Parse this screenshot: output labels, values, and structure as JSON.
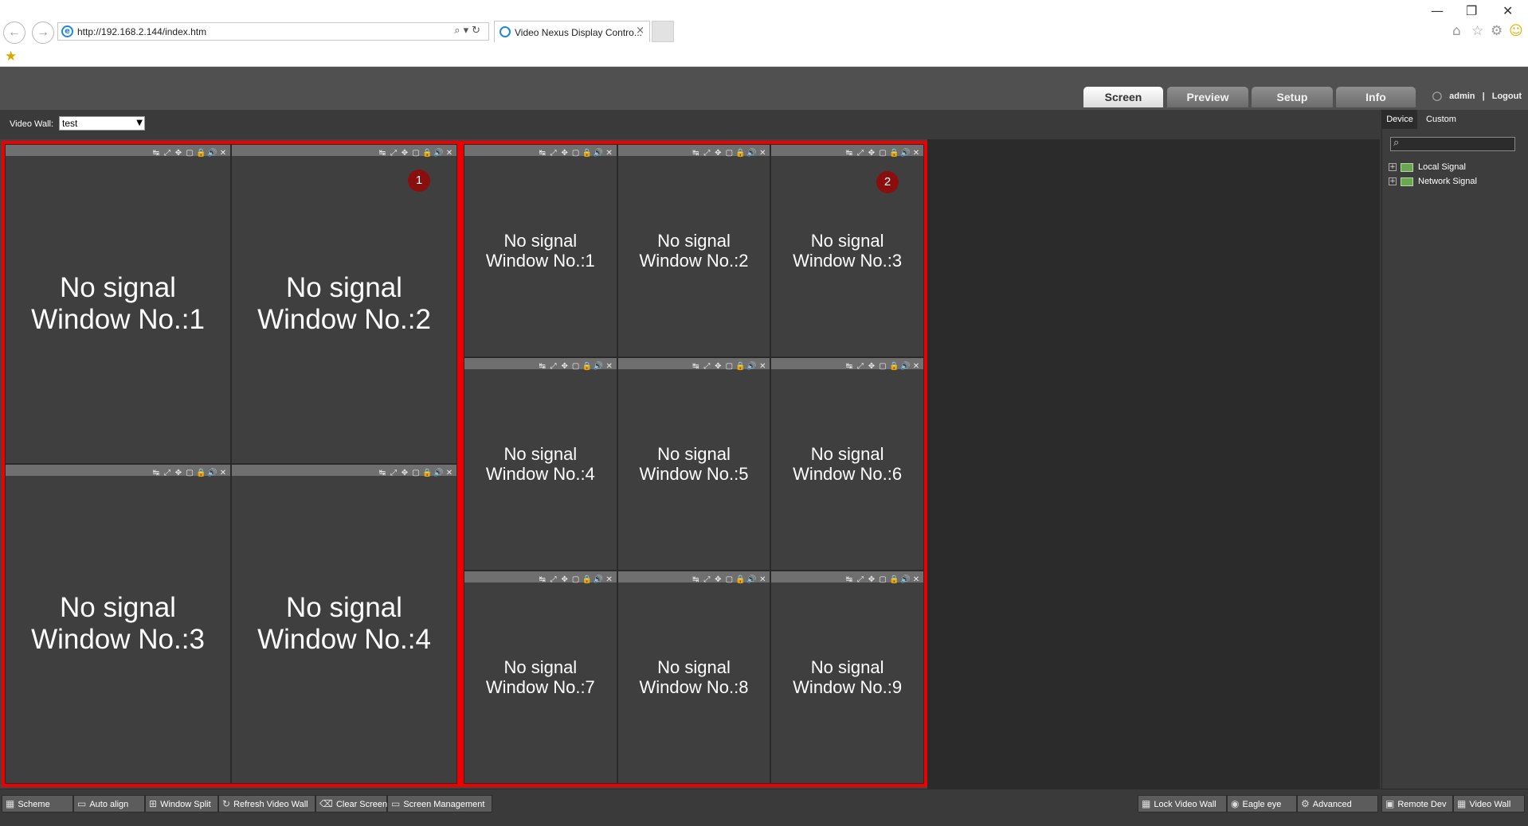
{
  "browser": {
    "url": "http://192.168.2.144/index.htm",
    "tab_title": "Video Nexus Display Contro...",
    "tab_close": "×",
    "back_glyph": "←",
    "forward_glyph": "→",
    "addr_tools": "⌕▾↻",
    "minimize_glyph": "—",
    "restore_glyph": "❐",
    "close_glyph": "✕",
    "home_glyph": "⌂",
    "fav_glyph": "☆",
    "settings_glyph": "⚙",
    "feedback_glyph": "☺",
    "fav_bar_glyph": "★"
  },
  "nav_tabs": [
    {
      "label": "Screen",
      "active": true
    },
    {
      "label": "Preview",
      "active": false
    },
    {
      "label": "Setup",
      "active": false
    },
    {
      "label": "Info",
      "active": false
    }
  ],
  "user": {
    "name": "admin",
    "separator": "|",
    "logout": "Logout",
    "icon": "user-icon"
  },
  "video_wall": {
    "label": "Video Wall:",
    "selected": "test",
    "arrow": "▼"
  },
  "side_panel": {
    "tabs": [
      {
        "label": "Device",
        "active": true
      },
      {
        "label": "Custom",
        "active": false
      }
    ],
    "search_icon": "⌕",
    "tree": [
      {
        "label": "Local Signal",
        "expander": "+"
      },
      {
        "label": "Network Signal",
        "expander": "+"
      }
    ]
  },
  "window_tools": [
    "↹",
    "⤢",
    "✥",
    "▢",
    "🔒",
    "🔊",
    "✕"
  ],
  "screens": [
    {
      "badge": "1",
      "windows": [
        {
          "line1": "No signal",
          "line2": "Window No.:1"
        },
        {
          "line1": "No signal",
          "line2": "Window No.:2"
        },
        {
          "line1": "No signal",
          "line2": "Window No.:3"
        },
        {
          "line1": "No signal",
          "line2": "Window No.:4"
        }
      ]
    },
    {
      "badge": "2",
      "windows": [
        {
          "line1": "No signal",
          "line2": "Window No.:1"
        },
        {
          "line1": "No signal",
          "line2": "Window No.:2"
        },
        {
          "line1": "No signal",
          "line2": "Window No.:3"
        },
        {
          "line1": "No signal",
          "line2": "Window No.:4"
        },
        {
          "line1": "No signal",
          "line2": "Window No.:5"
        },
        {
          "line1": "No signal",
          "line2": "Window No.:6"
        },
        {
          "line1": "No signal",
          "line2": "Window No.:7"
        },
        {
          "line1": "No signal",
          "line2": "Window No.:8"
        },
        {
          "line1": "No signal",
          "line2": "Window No.:9"
        }
      ]
    }
  ],
  "bottom_left_buttons": [
    {
      "label": "Scheme",
      "icon": "▦"
    },
    {
      "label": "Auto align",
      "icon": "▭"
    },
    {
      "label": "Window Split",
      "icon": "⊞"
    },
    {
      "label": "Refresh Video Wall",
      "icon": "↻"
    },
    {
      "label": "Clear Screen",
      "icon": "⌫"
    },
    {
      "label": "Screen Management",
      "icon": "▭"
    }
  ],
  "bottom_right_buttons": [
    {
      "label": "Lock Video Wall",
      "icon": "▦"
    },
    {
      "label": "Eagle eye",
      "icon": "◉"
    },
    {
      "label": "Advanced",
      "icon": "⚙"
    },
    {
      "label": "Remote Dev",
      "icon": "▣"
    },
    {
      "label": "Video Wall",
      "icon": "▦"
    }
  ],
  "colors": {
    "screen_border": "#ee0000",
    "badge": "#8a0e0e",
    "window_bg": "#3f3f3f",
    "toolbar_bg": "#6f6f6f"
  }
}
